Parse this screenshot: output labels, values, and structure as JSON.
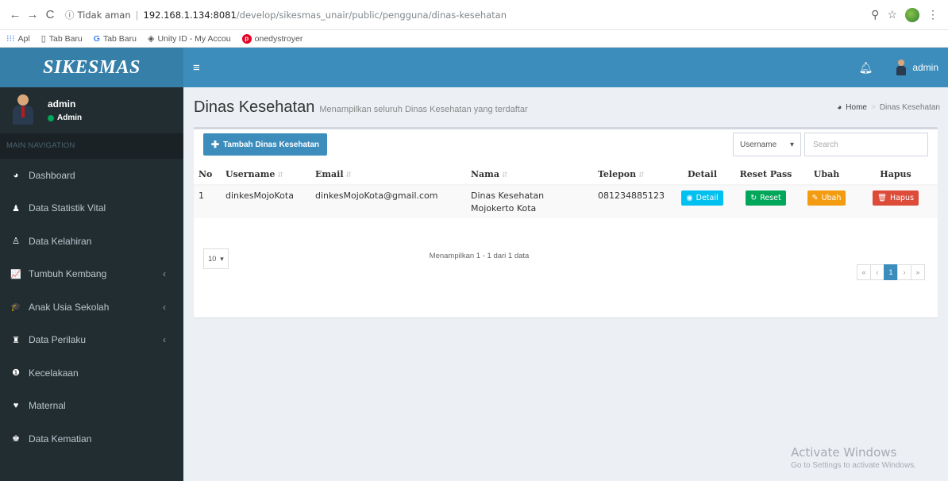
{
  "browser": {
    "insecure_label": "Tidak aman",
    "url_host": "192.168.1.134:8081",
    "url_path": "/develop/sikesmas_unair/public/pengguna/dinas-kesehatan",
    "bookmarks": [
      "Apl",
      "Tab Baru",
      "Tab Baru",
      "Unity ID - My Accou",
      "onedystroyer"
    ]
  },
  "app": {
    "logo": "SIKESMAS",
    "user_name": "admin",
    "user_role": "Admin",
    "topbar_user": "admin",
    "nav_header": "MAIN NAVIGATION"
  },
  "sidebar": {
    "items": [
      {
        "label": "Dashboard",
        "icon": "dashboard-icon",
        "chev": ""
      },
      {
        "label": "Data Statistik Vital",
        "icon": "user-icon",
        "chev": ""
      },
      {
        "label": "Data Kelahiran",
        "icon": "child-icon",
        "chev": ""
      },
      {
        "label": "Tumbuh Kembang",
        "icon": "line-chart-icon",
        "chev": "‹"
      },
      {
        "label": "Anak Usia Sekolah",
        "icon": "graduation-cap-icon",
        "chev": "‹"
      },
      {
        "label": "Data Perilaku",
        "icon": "binoculars-icon",
        "chev": "‹"
      },
      {
        "label": "Kecelakaan",
        "icon": "exclamation-icon",
        "chev": ""
      },
      {
        "label": "Maternal",
        "icon": "heartbeat-icon",
        "chev": ""
      },
      {
        "label": "Data Kematian",
        "icon": "users-icon",
        "chev": ""
      }
    ]
  },
  "header": {
    "title": "Dinas Kesehatan",
    "subtitle": "Menampilkan seluruh Dinas Kesehatan yang terdaftar",
    "breadcrumb_home": "Home",
    "breadcrumb_current": "Dinas Kesehatan"
  },
  "box": {
    "add_button": "Tambah Dinas Kesehatan",
    "filter_selected": "Username",
    "search_placeholder": "Search",
    "columns": [
      "No",
      "Username",
      "Email",
      "Nama",
      "Telepon",
      "Detail",
      "Reset Pass",
      "Ubah",
      "Hapus"
    ],
    "rows": [
      {
        "no": "1",
        "username": "dinkesMojoKota",
        "email": "dinkesMojoKota@gmail.com",
        "nama_line1": "Dinas Kesehatan",
        "nama_line2": "Mojokerto Kota",
        "telepon": "081234885123",
        "detail": "Detail",
        "reset": "Reset",
        "ubah": "Ubah",
        "hapus": "Hapus"
      }
    ],
    "per_page": "10",
    "info": "Menampilkan 1 - 1 dari 1 data",
    "pagination": [
      "«",
      "‹",
      "1",
      "›",
      "»"
    ]
  },
  "watermark": {
    "title": "Activate Windows",
    "subtitle": "Go to Settings to activate Windows."
  }
}
